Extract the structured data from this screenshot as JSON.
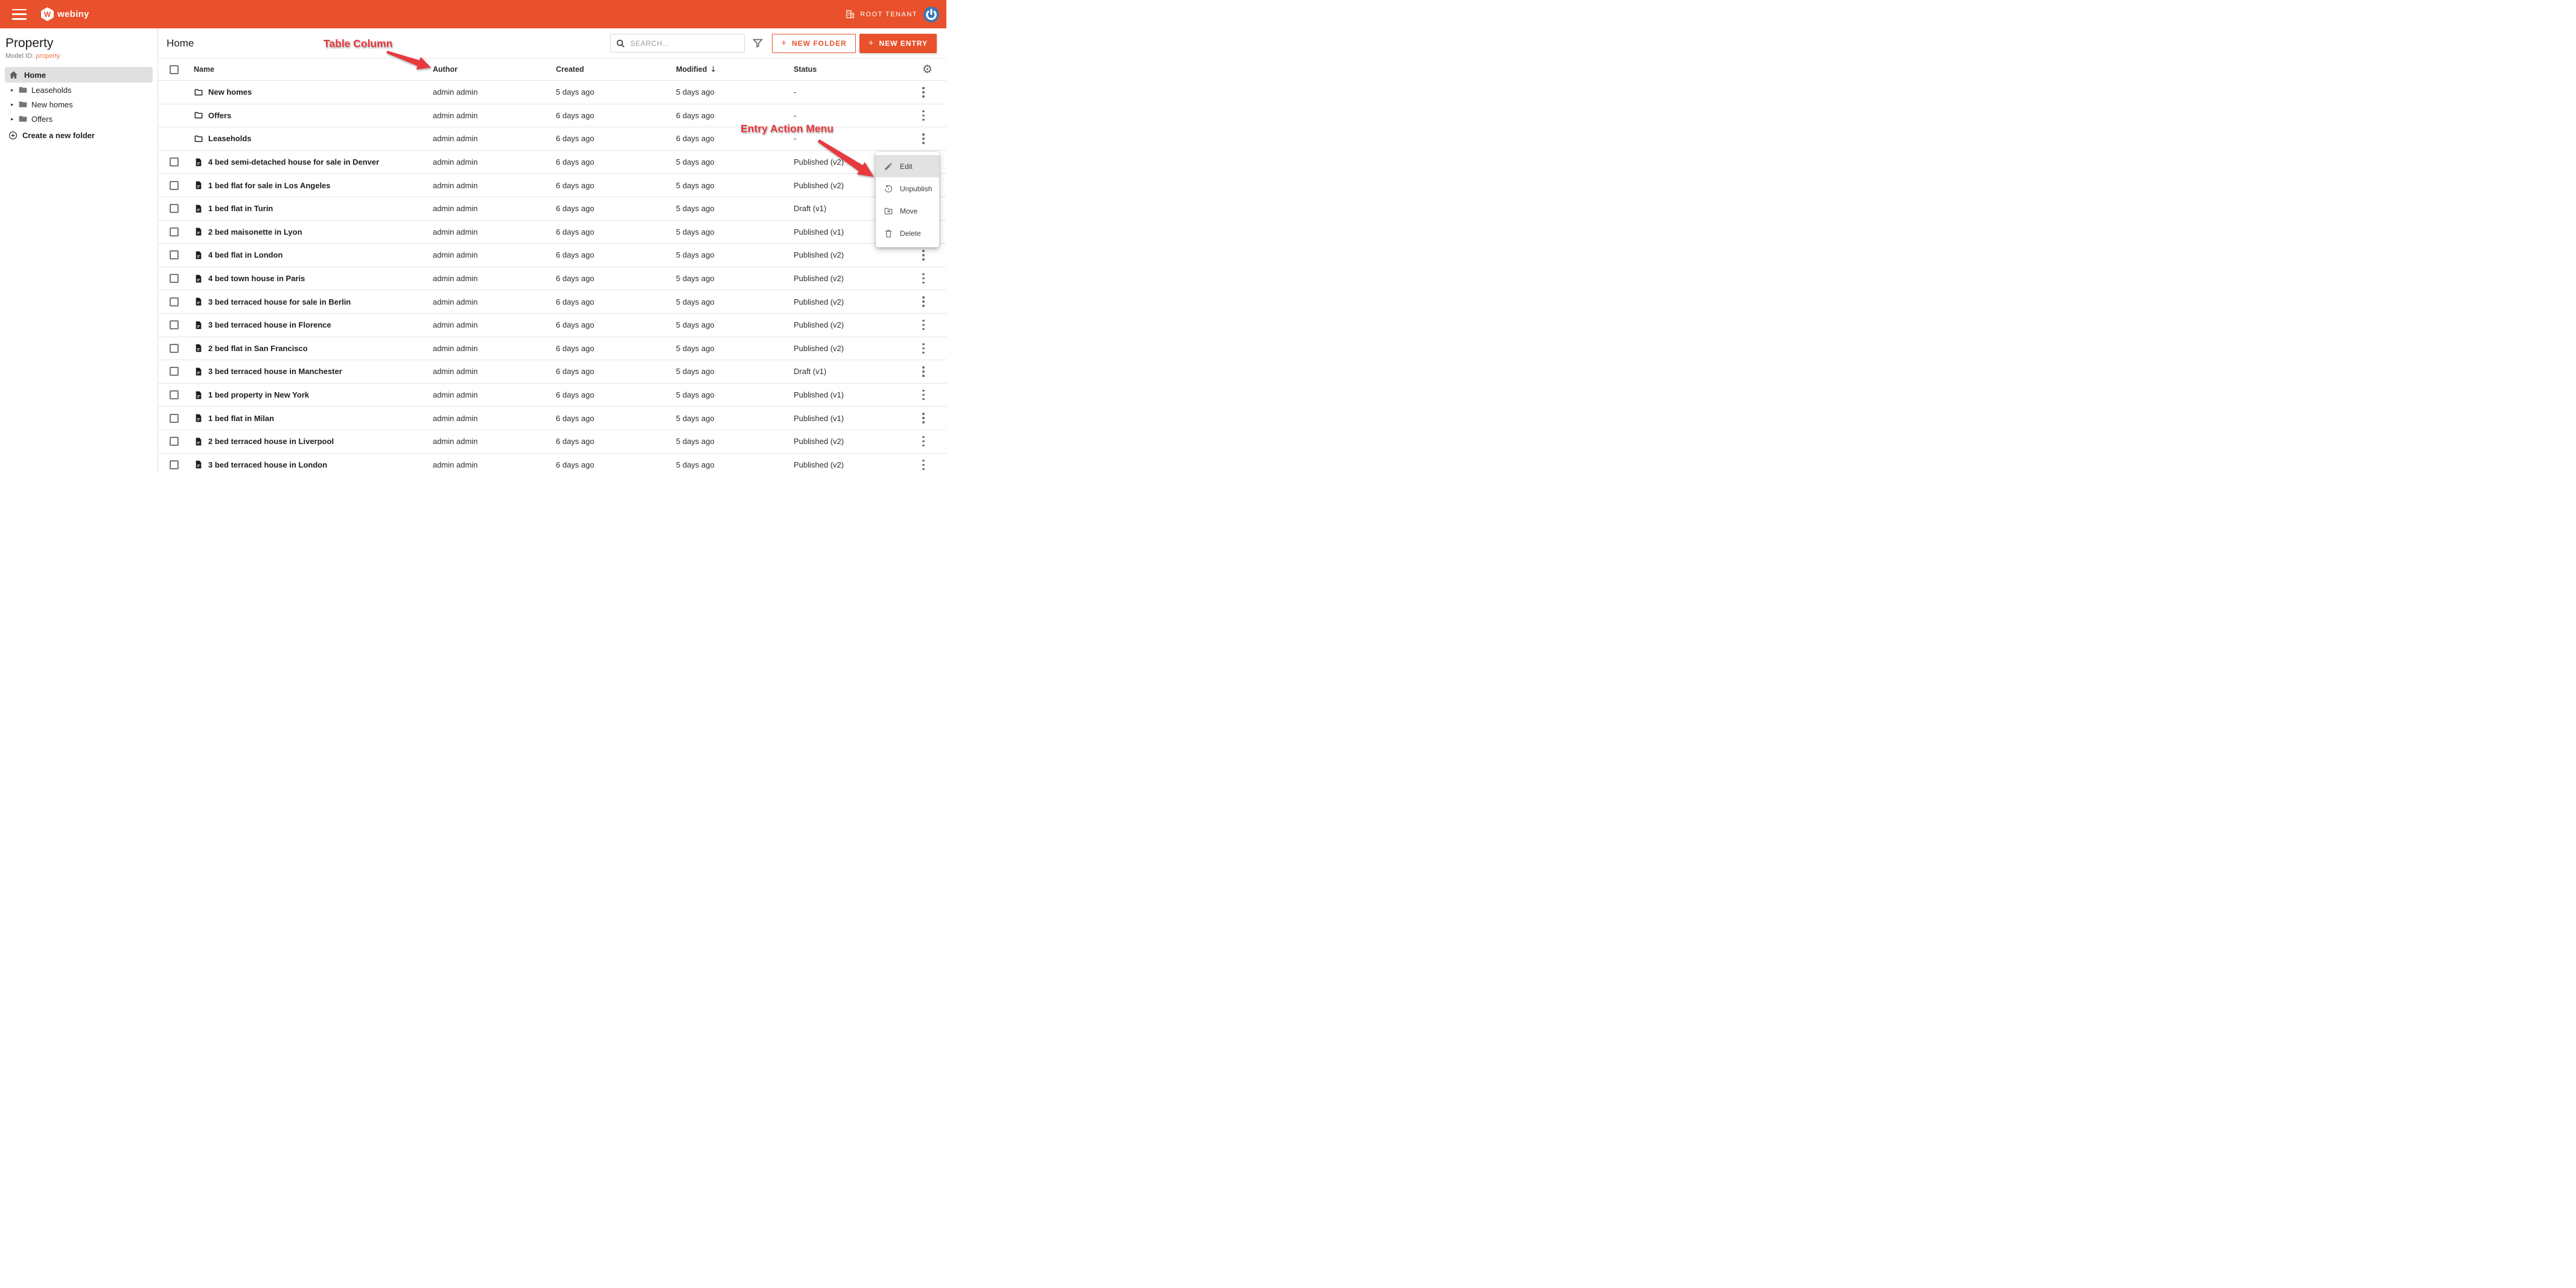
{
  "colors": {
    "primary": "#e8512b",
    "annotation": "#e8393d",
    "avatar_blue": "#3a76b8",
    "selected_gray": "#e0e0e0"
  },
  "topbar": {
    "brand_letter": "W",
    "brand": "webiny",
    "tenant_label": "ROOT TENANT"
  },
  "sidebar": {
    "title": "Property",
    "model_id_label": "Model ID:",
    "model_id_value": "property",
    "home_label": "Home",
    "tree_items": [
      {
        "label": "Leaseholds"
      },
      {
        "label": "New homes"
      },
      {
        "label": "Offers"
      }
    ],
    "create_folder_label": "Create a new folder"
  },
  "main": {
    "title": "Home",
    "search_placeholder": "SEARCH...",
    "new_folder_label": "NEW FOLDER",
    "new_entry_label": "NEW ENTRY",
    "plus": "+"
  },
  "table": {
    "columns": {
      "name": "Name",
      "author": "Author",
      "created": "Created",
      "modified": "Modified",
      "modified_sort_arrow": "↓",
      "status": "Status"
    },
    "rows": [
      {
        "type": "folder",
        "name": "New homes",
        "author": "admin admin",
        "created": "5 days ago",
        "modified": "5 days ago",
        "status": "-"
      },
      {
        "type": "folder",
        "name": "Offers",
        "author": "admin admin",
        "created": "6 days ago",
        "modified": "6 days ago",
        "status": "-"
      },
      {
        "type": "folder",
        "name": "Leaseholds",
        "author": "admin admin",
        "created": "6 days ago",
        "modified": "6 days ago",
        "status": "-"
      },
      {
        "type": "entry",
        "name": "4 bed semi-detached house for sale in Denver",
        "author": "admin admin",
        "created": "6 days ago",
        "modified": "5 days ago",
        "status": "Published (v2)"
      },
      {
        "type": "entry",
        "name": "1 bed flat for sale in Los Angeles",
        "author": "admin admin",
        "created": "6 days ago",
        "modified": "5 days ago",
        "status": "Published (v2)"
      },
      {
        "type": "entry",
        "name": "1 bed flat in Turin",
        "author": "admin admin",
        "created": "6 days ago",
        "modified": "5 days ago",
        "status": "Draft (v1)"
      },
      {
        "type": "entry",
        "name": "2 bed maisonette in Lyon",
        "author": "admin admin",
        "created": "6 days ago",
        "modified": "5 days ago",
        "status": "Published (v1)"
      },
      {
        "type": "entry",
        "name": "4 bed flat in London",
        "author": "admin admin",
        "created": "6 days ago",
        "modified": "5 days ago",
        "status": "Published (v2)"
      },
      {
        "type": "entry",
        "name": "4 bed town house in Paris",
        "author": "admin admin",
        "created": "6 days ago",
        "modified": "5 days ago",
        "status": "Published (v2)"
      },
      {
        "type": "entry",
        "name": "3 bed terraced house for sale in Berlin",
        "author": "admin admin",
        "created": "6 days ago",
        "modified": "5 days ago",
        "status": "Published (v2)"
      },
      {
        "type": "entry",
        "name": "3 bed terraced house in Florence",
        "author": "admin admin",
        "created": "6 days ago",
        "modified": "5 days ago",
        "status": "Published (v2)"
      },
      {
        "type": "entry",
        "name": "2 bed flat in San Francisco",
        "author": "admin admin",
        "created": "6 days ago",
        "modified": "5 days ago",
        "status": "Published (v2)"
      },
      {
        "type": "entry",
        "name": "3 bed terraced house in Manchester",
        "author": "admin admin",
        "created": "6 days ago",
        "modified": "5 days ago",
        "status": "Draft (v1)"
      },
      {
        "type": "entry",
        "name": "1 bed property in New York",
        "author": "admin admin",
        "created": "6 days ago",
        "modified": "5 days ago",
        "status": "Published (v1)"
      },
      {
        "type": "entry",
        "name": "1 bed flat in Milan",
        "author": "admin admin",
        "created": "6 days ago",
        "modified": "5 days ago",
        "status": "Published (v1)"
      },
      {
        "type": "entry",
        "name": "2 bed terraced house in Liverpool",
        "author": "admin admin",
        "created": "6 days ago",
        "modified": "5 days ago",
        "status": "Published (v2)"
      },
      {
        "type": "entry",
        "name": "3 bed terraced house in London",
        "author": "admin admin",
        "created": "6 days ago",
        "modified": "5 days ago",
        "status": "Published (v2)"
      }
    ]
  },
  "context_menu": {
    "items": [
      {
        "icon": "pencil-icon",
        "label": "Edit",
        "highlighted": true
      },
      {
        "icon": "unpublish-icon",
        "label": "Unpublish",
        "highlighted": false
      },
      {
        "icon": "move-folder-icon",
        "label": "Move",
        "highlighted": false
      },
      {
        "icon": "trash-icon",
        "label": "Delete",
        "highlighted": false
      }
    ]
  },
  "annotations": {
    "table_column": "Table Column",
    "entry_action_menu": "Entry Action Menu"
  }
}
